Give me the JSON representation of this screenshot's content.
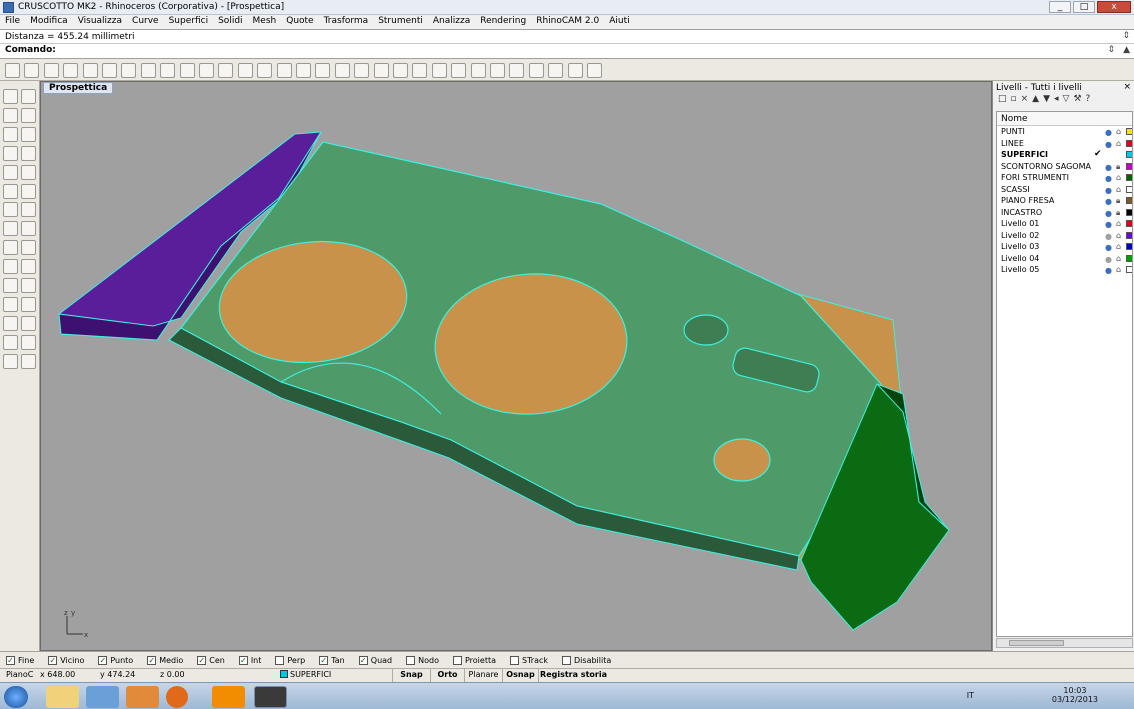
{
  "window": {
    "title": "CRUSCOTTO MK2 - Rhinoceros (Corporativa) - [Prospettica]",
    "buttons": [
      "_",
      "□",
      "x"
    ]
  },
  "menu": [
    "File",
    "Modifica",
    "Visualizza",
    "Curve",
    "Superfici",
    "Solidi",
    "Mesh",
    "Quote",
    "Trasforma",
    "Strumenti",
    "Analizza",
    "Rendering",
    "RhinoCAM 2.0",
    "Aiuti"
  ],
  "command": {
    "history": "Distanza = 455.24 millimetri",
    "prompt": "Comando:"
  },
  "viewport": {
    "title": "Prospettica",
    "axes": {
      "x": "x",
      "y": "y",
      "z": "z"
    }
  },
  "layers_panel": {
    "title": "Livelli - Tutti i livelli",
    "column": "Nome",
    "layers": [
      {
        "name": "PUNTI",
        "color": "#f2e600",
        "on": true,
        "locked": false,
        "current": false
      },
      {
        "name": "LINEE",
        "color": "#e0001b",
        "on": true,
        "locked": false,
        "current": false
      },
      {
        "name": "SUPERFICI",
        "color": "#00c8e6",
        "on": true,
        "locked": false,
        "current": true
      },
      {
        "name": "SCONTORNO SAGOMA",
        "color": "#cc00cc",
        "on": true,
        "locked": true,
        "current": false
      },
      {
        "name": "FORI STRUMENTI",
        "color": "#006400",
        "on": true,
        "locked": false,
        "current": false
      },
      {
        "name": "SCASSI",
        "color": "#ffffff",
        "on": true,
        "locked": false,
        "current": false
      },
      {
        "name": "PIANO FRESA",
        "color": "#7a5a2a",
        "on": true,
        "locked": true,
        "current": false
      },
      {
        "name": "INCASTRO",
        "color": "#000000",
        "on": true,
        "locked": true,
        "current": false
      },
      {
        "name": "Livello 01",
        "color": "#e0001b",
        "on": true,
        "locked": false,
        "current": false
      },
      {
        "name": "Livello 02",
        "color": "#6a0ad6",
        "on": false,
        "locked": false,
        "current": false
      },
      {
        "name": "Livello 03",
        "color": "#0000c8",
        "on": true,
        "locked": false,
        "current": false
      },
      {
        "name": "Livello 04",
        "color": "#00a000",
        "on": false,
        "locked": false,
        "current": false
      },
      {
        "name": "Livello 05",
        "color": "#ffffff",
        "on": true,
        "locked": false,
        "current": false
      }
    ]
  },
  "osnap": [
    {
      "label": "Fine",
      "checked": true
    },
    {
      "label": "Vicino",
      "checked": true
    },
    {
      "label": "Punto",
      "checked": true
    },
    {
      "label": "Medio",
      "checked": true
    },
    {
      "label": "Cen",
      "checked": true
    },
    {
      "label": "Int",
      "checked": true
    },
    {
      "label": "Perp",
      "checked": false
    },
    {
      "label": "Tan",
      "checked": true
    },
    {
      "label": "Quad",
      "checked": true
    },
    {
      "label": "Nodo",
      "checked": false
    },
    {
      "label": "Proietta",
      "checked": false
    },
    {
      "label": "STrack",
      "checked": false
    },
    {
      "label": "Disabilita",
      "checked": false
    }
  ],
  "status": {
    "cplane": "PianoC",
    "x": "x 648.00",
    "y": "y 474.24",
    "z": "z 0.00",
    "layer": "SUPERFICI",
    "layer_color": "#00c8e6",
    "buttons": [
      "Snap",
      "Orto",
      "Planare",
      "Osnap",
      "Registra storia"
    ]
  },
  "taskbar": {
    "lang": "IT",
    "time": "10:03",
    "date": "03/12/2013"
  },
  "icons": {
    "toolbar": [
      "new-file-icon",
      "open-icon",
      "save-icon",
      "print-icon",
      "import-icon",
      "cut-icon",
      "copy-icon",
      "paste-icon",
      "undo-icon",
      "pan-hand-icon",
      "rotate-view-icon",
      "zoom-icon",
      "zoom-window-icon",
      "zoom-extents-icon",
      "zoom-selected-icon",
      "rotate-icon",
      "four-viewports-icon",
      "car-icon",
      "hide-icon",
      "show-icon",
      "lightbulb-icon",
      "lock-icon",
      "layer-color-icon",
      "render-icon",
      "color-wheel-icon",
      "materials-icon",
      "globe-icon",
      "dimension-icon",
      "gears-icon",
      "options-icon",
      "help-icon"
    ],
    "left": [
      "point-icon",
      "select-icon",
      "polyline-icon",
      "curve-icon",
      "circle-icon",
      "arc-icon",
      "rectangle-icon",
      "polygon-icon",
      "fillet-icon",
      "surface-icon",
      "extrude-icon",
      "box-icon",
      "boolean-icon",
      "sphere-icon",
      "solid-icon",
      "cylinder-icon",
      "transform-icon",
      "array-icon",
      "trim-icon",
      "split-icon",
      "analyze-icon",
      "join-icon",
      "move-icon",
      "scale-icon",
      "mirror-icon",
      "cpl-icon",
      "dim-icon",
      "grid-icon",
      "render-small-icon",
      "shade-icon"
    ]
  },
  "colors": {
    "viewport_bg": "#a0a0a0",
    "panel_body": "#4e9a68",
    "pocket": "#c8924a",
    "left_block": "#5a1e9a",
    "right_block": "#0b6b12",
    "edge": "#3cf0e0"
  }
}
